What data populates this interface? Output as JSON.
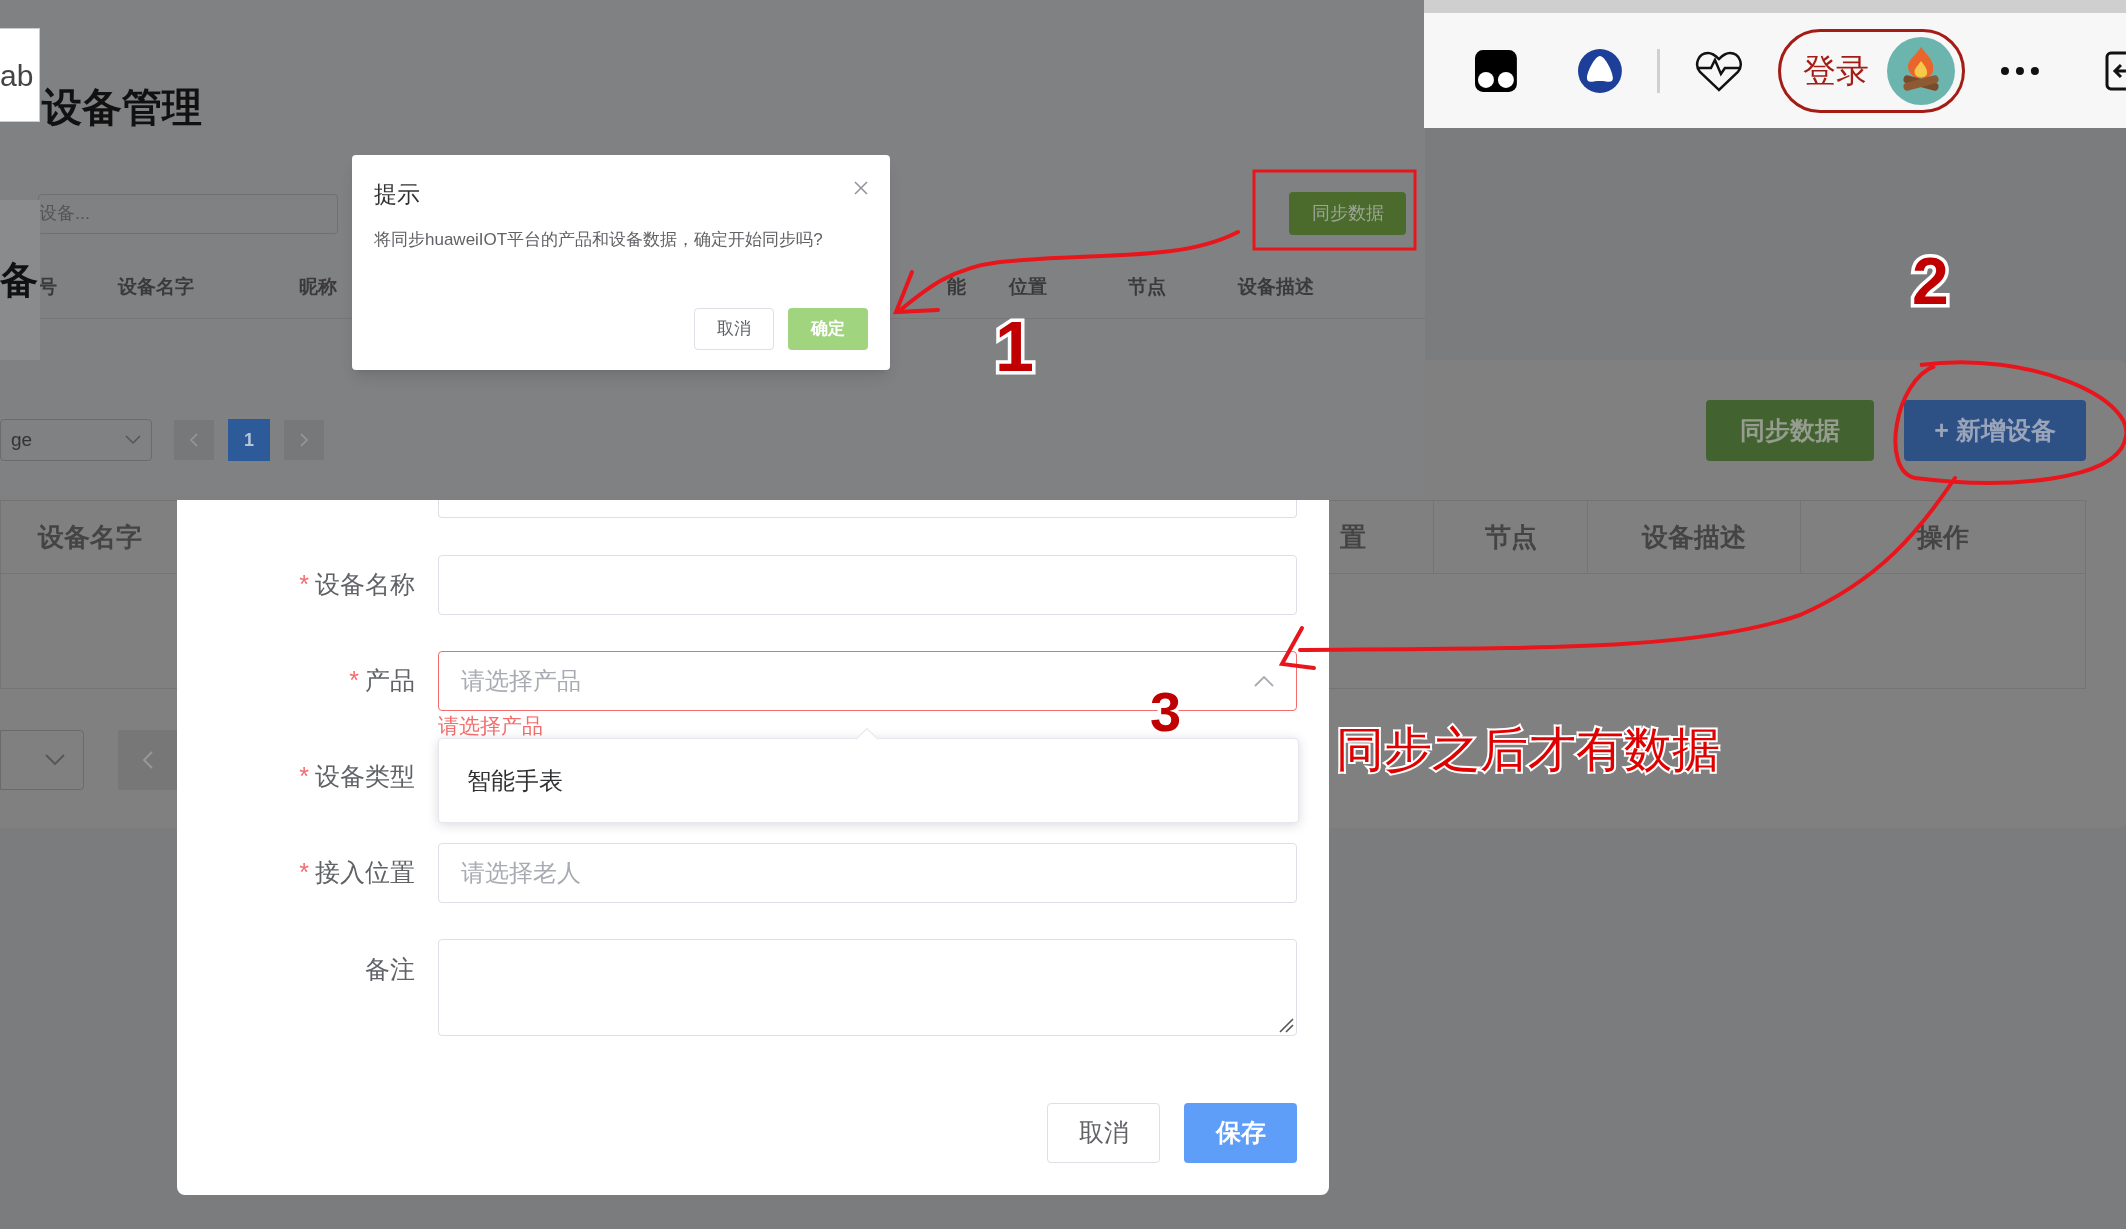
{
  "browser_toolbar": {
    "login_label": "登录"
  },
  "left_fragments": {
    "tab_text": "ab",
    "heading_char": "备"
  },
  "back_page": {
    "title": "设备管理",
    "search": {
      "placeholder": "设备..."
    },
    "sync_button": "同步数据",
    "columns": [
      "号",
      "设备名字",
      "昵称",
      "",
      "能",
      "位置",
      "节点",
      "设备描述"
    ],
    "pagination": {
      "page_size": "ge",
      "pages": [
        {
          "label": "1",
          "selected": true
        }
      ]
    }
  },
  "confirm_dialog": {
    "title": "提示",
    "message": "将同步huaweiIOT平台的产品和设备数据，确定开始同步吗?",
    "buttons": [
      {
        "label": "取消",
        "kind": "default"
      },
      {
        "label": "确定",
        "kind": "primary"
      }
    ]
  },
  "device_page": {
    "buttons": [
      {
        "label": "同步数据",
        "kind": "success"
      },
      {
        "label": "+ 新增设备",
        "kind": "primary"
      }
    ],
    "columns": [
      "设备名字",
      "置",
      "节点",
      "设备描述",
      "操作"
    ]
  },
  "device_form": {
    "fields": [
      {
        "label": "设备名称",
        "required_mark": "*",
        "kind": "input"
      },
      {
        "label": "产品",
        "required_mark": "*",
        "kind": "select",
        "placeholder": "请选择产品",
        "error": "请选择产品",
        "expanded": true,
        "options": [
          "智能手表"
        ]
      },
      {
        "label": "设备类型",
        "required_mark": "*",
        "kind": "covered"
      },
      {
        "label": "接入位置",
        "required_mark": "*",
        "kind": "input",
        "placeholder": "请选择老人"
      },
      {
        "label": "备注",
        "kind": "textarea"
      }
    ],
    "buttons": [
      {
        "label": "取消",
        "kind": "default"
      },
      {
        "label": "保存",
        "kind": "primary"
      }
    ]
  },
  "annotations": [
    {
      "kind": "digit",
      "text": "1"
    },
    {
      "kind": "digit",
      "text": "2"
    },
    {
      "kind": "digit",
      "text": "3"
    },
    {
      "kind": "note",
      "text": "同步之后才有数据"
    }
  ]
}
